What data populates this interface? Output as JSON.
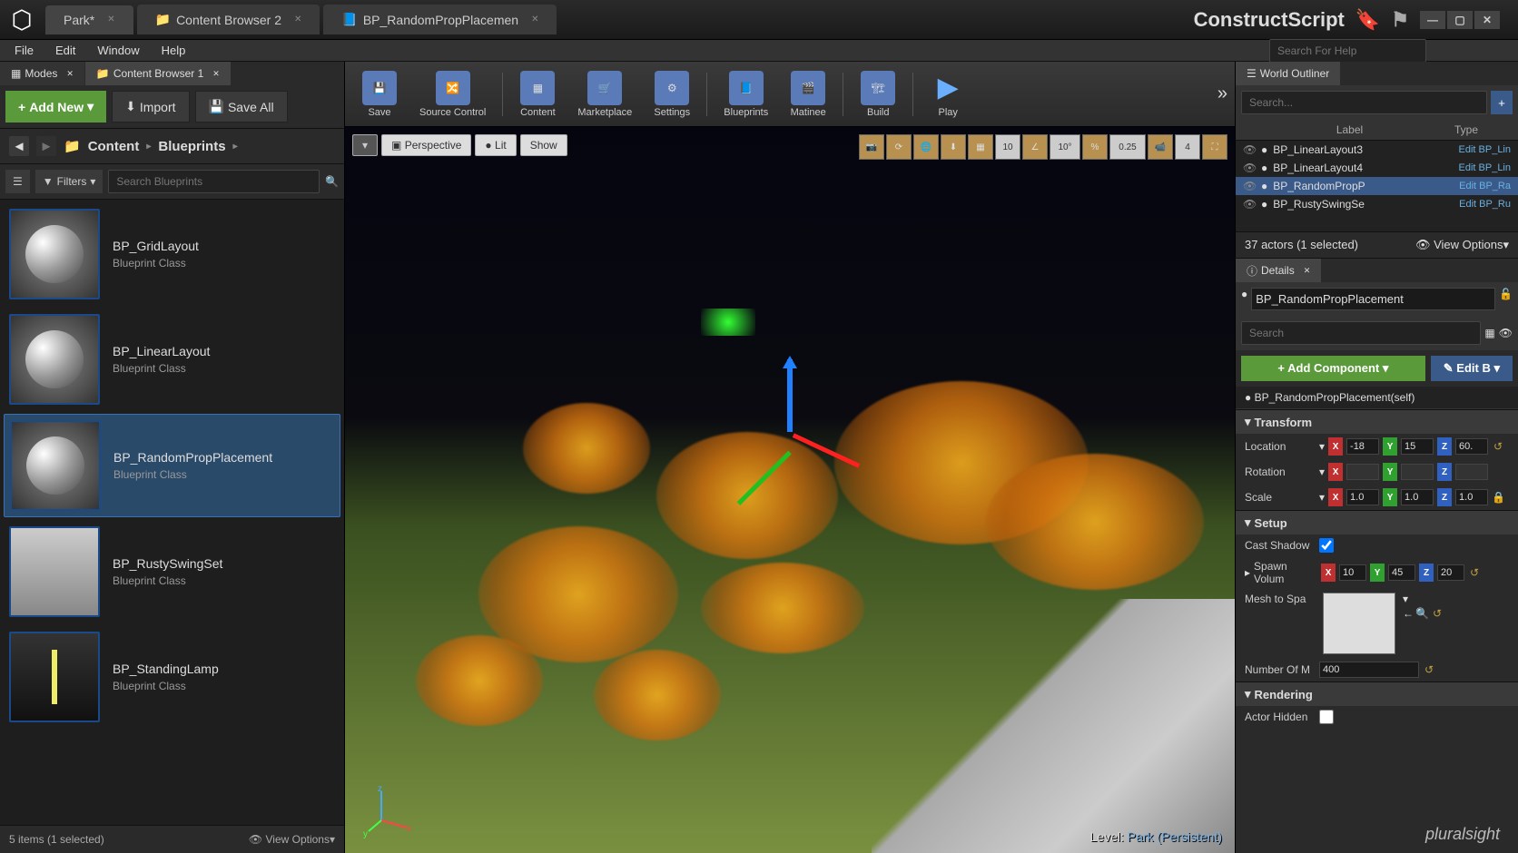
{
  "titlebar": {
    "tabs": [
      {
        "label": "Park*",
        "icon": "level"
      },
      {
        "label": "Content Browser 2",
        "icon": "folder"
      },
      {
        "label": "BP_RandomPropPlacemen",
        "icon": "blueprint"
      }
    ],
    "app_title": "ConstructScript"
  },
  "menu": [
    "File",
    "Edit",
    "Window",
    "Help"
  ],
  "left": {
    "tabs": [
      "Modes",
      "Content Browser 1"
    ],
    "add_new": "Add New",
    "import": "Import",
    "save_all": "Save All",
    "breadcrumb": [
      "Content",
      "Blueprints"
    ],
    "filters": "Filters",
    "search_placeholder": "Search Blueprints",
    "assets": [
      {
        "name": "BP_GridLayout",
        "type": "Blueprint Class",
        "thumb": "sphere"
      },
      {
        "name": "BP_LinearLayout",
        "type": "Blueprint Class",
        "thumb": "sphere"
      },
      {
        "name": "BP_RandomPropPlacement",
        "type": "Blueprint Class",
        "thumb": "sphere",
        "selected": true
      },
      {
        "name": "BP_RustySwingSet",
        "type": "Blueprint Class",
        "thumb": "swing"
      },
      {
        "name": "BP_StandingLamp",
        "type": "Blueprint Class",
        "thumb": "lamp"
      }
    ],
    "footer_count": "5 items (1 selected)",
    "view_options": "View Options"
  },
  "toolbar": [
    {
      "label": "Save"
    },
    {
      "label": "Source Control"
    },
    {
      "label": "Content"
    },
    {
      "label": "Marketplace"
    },
    {
      "label": "Settings"
    },
    {
      "label": "Blueprints"
    },
    {
      "label": "Matinee"
    },
    {
      "label": "Build"
    },
    {
      "label": "Play"
    }
  ],
  "viewport": {
    "buttons": [
      "Perspective",
      "Lit",
      "Show"
    ],
    "snap_angle": "10°",
    "snap_scale": "0.25",
    "snap_grid": "10",
    "grid_count": "4",
    "level_prefix": "Level:",
    "level_name": "Park (Persistent)"
  },
  "outliner": {
    "title": "World Outliner",
    "search_placeholder": "Search...",
    "col_label": "Label",
    "col_type": "Type",
    "items": [
      {
        "name": "BP_LinearLayout3",
        "edit": "Edit BP_Lin"
      },
      {
        "name": "BP_LinearLayout4",
        "edit": "Edit BP_Lin"
      },
      {
        "name": "BP_RandomPropP",
        "edit": "Edit BP_Ra",
        "selected": true
      },
      {
        "name": "BP_RustySwingSe",
        "edit": "Edit BP_Ru"
      }
    ],
    "count": "37 actors (1 selected)",
    "view_options": "View Options"
  },
  "details": {
    "title": "Details",
    "selected": "BP_RandomPropPlacement",
    "search_placeholder": "Search",
    "add_component": "Add Component",
    "edit_bp": "Edit B",
    "component_self": "BP_RandomPropPlacement(self)",
    "sections": {
      "transform": {
        "title": "Transform",
        "location_label": "Location",
        "rotation_label": "Rotation",
        "scale_label": "Scale",
        "loc": {
          "x": "-18",
          "y": "15",
          "z": "60."
        },
        "scale": {
          "x": "1.0",
          "y": "1.0",
          "z": "1.0"
        }
      },
      "setup": {
        "title": "Setup",
        "cast_shadow": "Cast Shadow",
        "spawn_volume": "Spawn Volum",
        "vol": {
          "x": "10",
          "y": "45",
          "z": "20"
        },
        "mesh_to_spawn": "Mesh to Spa",
        "number_of_m": "Number Of M",
        "number_value": "400"
      },
      "rendering": {
        "title": "Rendering",
        "actor_hidden": "Actor Hidden"
      }
    }
  },
  "search_help_placeholder": "Search For Help",
  "watermark": "pluralsight"
}
